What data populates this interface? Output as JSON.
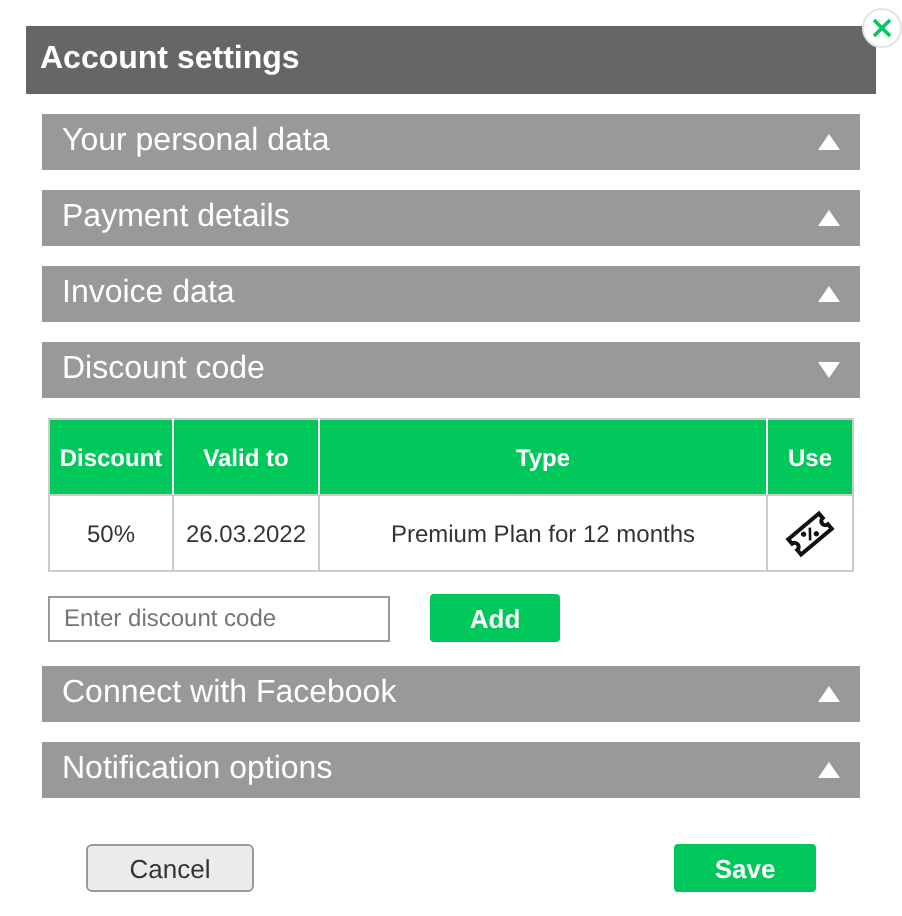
{
  "dialog": {
    "title": "Account settings"
  },
  "sections": [
    {
      "title": "Your personal data",
      "expanded": false
    },
    {
      "title": "Payment details",
      "expanded": false
    },
    {
      "title": "Invoice data",
      "expanded": false
    },
    {
      "title": "Discount code",
      "expanded": true,
      "table": {
        "columns": [
          "Discount",
          "Valid to",
          "Type",
          "Use"
        ],
        "rows": [
          [
            "50%",
            "26.03.2022",
            "Premium Plan for 12 months"
          ]
        ]
      },
      "code_field": {
        "placeholder": "Enter discount code"
      },
      "add_button": "Add"
    },
    {
      "title": "Connect with Facebook",
      "expanded": false
    },
    {
      "title": "Notification options",
      "expanded": false
    }
  ],
  "buttons": {
    "cancel": "Cancel",
    "save": "Save"
  }
}
